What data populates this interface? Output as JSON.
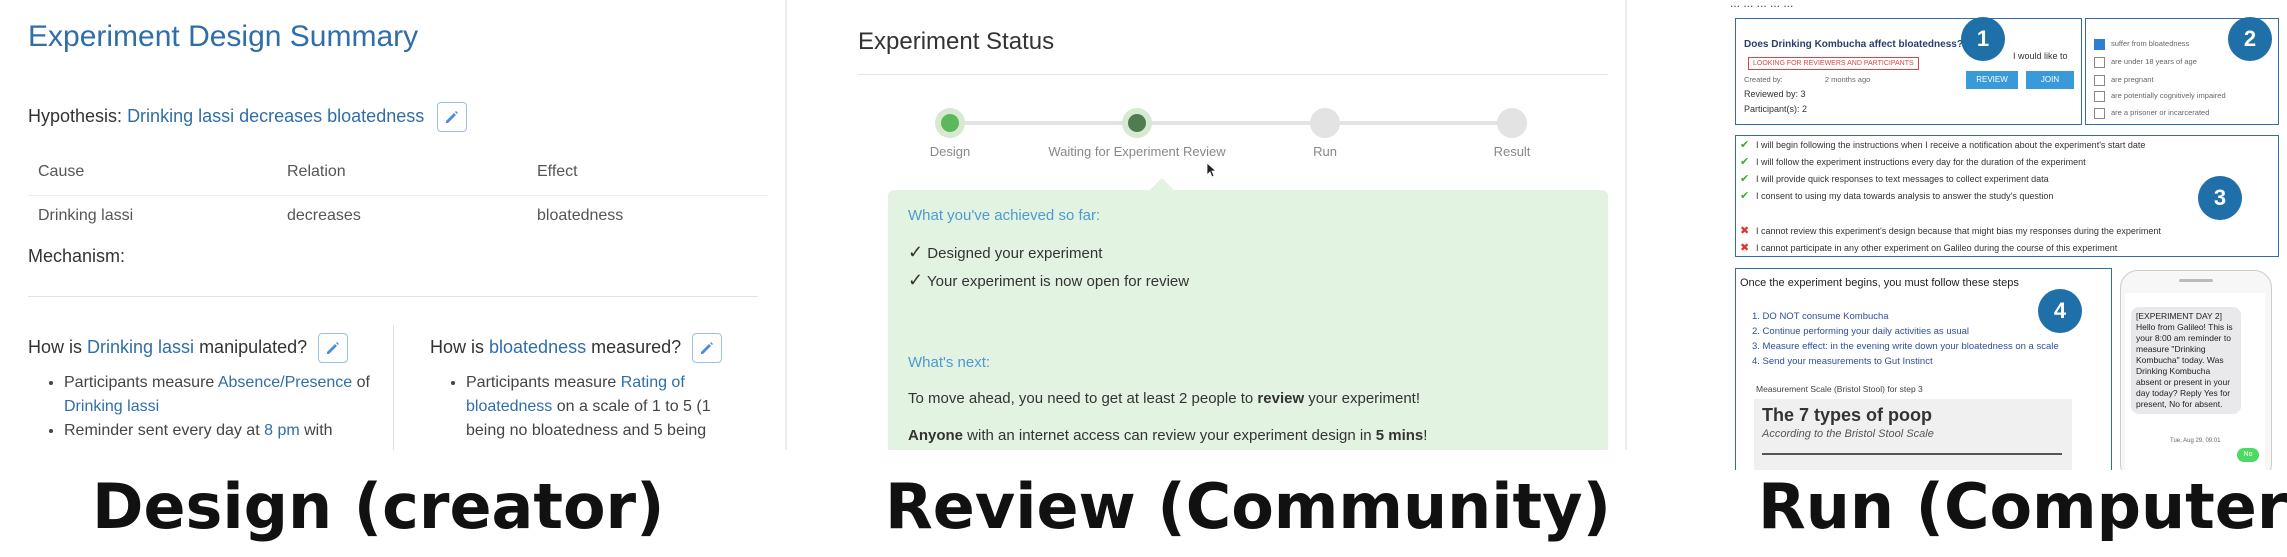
{
  "design": {
    "title": "Experiment Design Summary",
    "hypothesis_label": "Hypothesis:",
    "hypothesis_value": "Drinking lassi decreases bloatedness",
    "table": {
      "headers": [
        "Cause",
        "Relation",
        "Effect"
      ],
      "row": [
        "Drinking lassi",
        "decreases",
        "bloatedness"
      ]
    },
    "mechanism_label": "Mechanism:",
    "manipulated": {
      "q_prefix": "How is ",
      "q_link": "Drinking lassi",
      "q_suffix": " manipulated?",
      "b1_a": "Participants measure ",
      "b1_link": "Absence/Presence",
      "b1_b": " of ",
      "b1_link2": "Drinking lassi",
      "b2_a": "Reminder sent every day at ",
      "b2_link": "8 pm",
      "b2_b": " with"
    },
    "measured": {
      "q_prefix": "How is ",
      "q_link": "bloatedness",
      "q_suffix": " measured?",
      "b1_a": "Participants measure ",
      "b1_link": "Rating of bloatedness",
      "b1_b": " on a scale of 1 to 5 (1 being no bloatedness and 5 being"
    }
  },
  "review": {
    "title": "Experiment Status",
    "steps": [
      {
        "label": "Design",
        "state": "done"
      },
      {
        "label": "Waiting for Experiment Review",
        "state": "current"
      },
      {
        "label": "Run",
        "state": "todo"
      },
      {
        "label": "Result",
        "state": "todo"
      }
    ],
    "achieved_heading": "What you've achieved so far:",
    "achieved": [
      "Designed your experiment",
      "Your experiment is now open for review"
    ],
    "next_heading": "What's next:",
    "next_1a": "To move ahead, you need to get at least 2 people to ",
    "next_1b": "review",
    "next_1c": " your experiment!",
    "next_2a": "Anyone",
    "next_2b": " with an internet access can review your experiment design in ",
    "next_2c": "5 mins",
    "next_2d": "!"
  },
  "run": {
    "top_cut_text": "... ... ... ... ...",
    "q_title": "Does Drinking Kombucha affect bloatedness?",
    "badge": "LOOKING FOR REVIEWERS AND PARTICIPANTS",
    "created_by": "Created by:",
    "created_ago": "2 months ago",
    "reviewed_by": "Reviewed by: 3",
    "participants": "Participant(s): 2",
    "i_would_like": "I would like to",
    "review_btn": "REVIEW",
    "join_btn": "JOIN",
    "numbers": [
      "1",
      "2",
      "3",
      "4"
    ],
    "eligibility": [
      "suffer from bloatedness",
      "are under 18 years of age",
      "are pregnant",
      "are potentially cognitively impaired",
      "are a prisoner or incarcerated"
    ],
    "consents": [
      "I will begin following the instructions when I receive a notification about the experiment's start date",
      "I will follow the experiment instructions every day for the duration of the experiment",
      "I will provide quick responses to text messages to collect experiment data",
      "I consent to using my data towards analysis to answer the study's question"
    ],
    "exclusions": [
      "I cannot review this experiment's design because that might bias my responses during the experiment",
      "I cannot participate in any other experiment on Galileo during the course of this experiment"
    ],
    "steps_title": "Once the experiment begins, you must follow these steps",
    "steps": [
      "1. DO NOT consume Kombucha",
      "2. Continue performing your daily activities as usual",
      "3. Measure effect: in the evening write down your bloatedness on a scale",
      "4. Send your measurements to Gut Instinct"
    ],
    "scale_label": "Measurement Scale (Bristol Stool) for step 3",
    "poop_title": "The 7 types of poop",
    "poop_sub": "According to the Bristol Stool Scale",
    "sms": "[EXPERIMENT DAY 2] Hello from Galileo! This is your 8:00 am reminder to measure \"Drinking Kombucha\" today.  Was Drinking Kombucha absent or present in your day today? Reply Yes for present, No for absent.",
    "sms_time": "Tue, Aug 29, 09:01",
    "reply": "No"
  },
  "captions": [
    "Design (creator)",
    "Review (Community)",
    "Run (Computers)"
  ],
  "colors": {
    "link": "#2f6ea8",
    "green_box": "#e2f3e1",
    "step_green": "#5cb85c",
    "badge_blue": "#1f6fa8"
  }
}
